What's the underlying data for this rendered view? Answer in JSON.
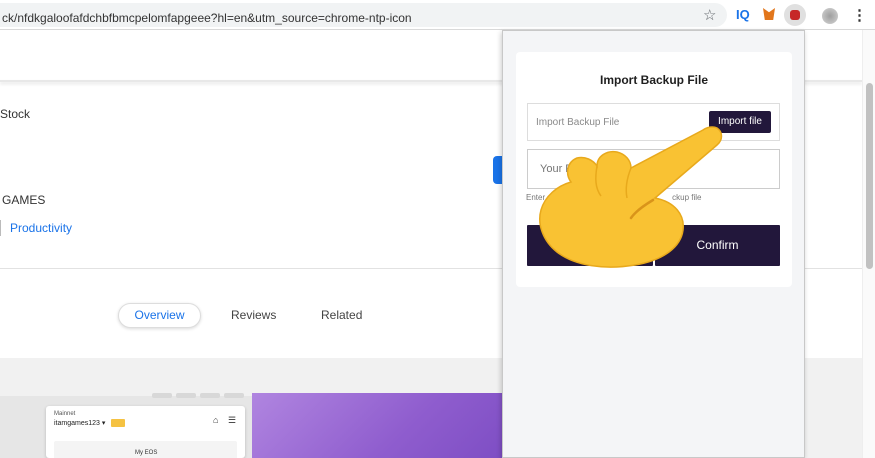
{
  "browser": {
    "url": "ck/nfdkgaloofafdchbfbmcpelomfapgeee?hl=en&utm_source=chrome-ntp-icon",
    "extension_iq_label": "IQ"
  },
  "store_page": {
    "stock_text": "Stock",
    "games_text": "GAMES",
    "category_link": "Productivity",
    "tabs": [
      "Overview",
      "Reviews",
      "Related"
    ],
    "active_tab": "Overview",
    "screenshot": {
      "network": "Mainnet",
      "account": "itamgames123",
      "account_caret": "▾",
      "card_title": "My EOS"
    }
  },
  "popup": {
    "title": "Import Backup File",
    "file_field_label": "Import Backup File",
    "import_button": "Import file",
    "password_placeholder": "Your P",
    "hint_left": "Enter",
    "hint_right": "ckup file",
    "cancel_button": "cel",
    "confirm_button": "Confirm"
  },
  "colors": {
    "brand_dark": "#22173b",
    "link_blue": "#1a73e8",
    "hand_yellow": "#f9c233"
  },
  "icons": [
    "star-icon",
    "metamask-fox-icon",
    "extension-icon",
    "avatar",
    "more-vert-icon",
    "home-icon",
    "menu-icon",
    "pointing-hand-icon"
  ]
}
